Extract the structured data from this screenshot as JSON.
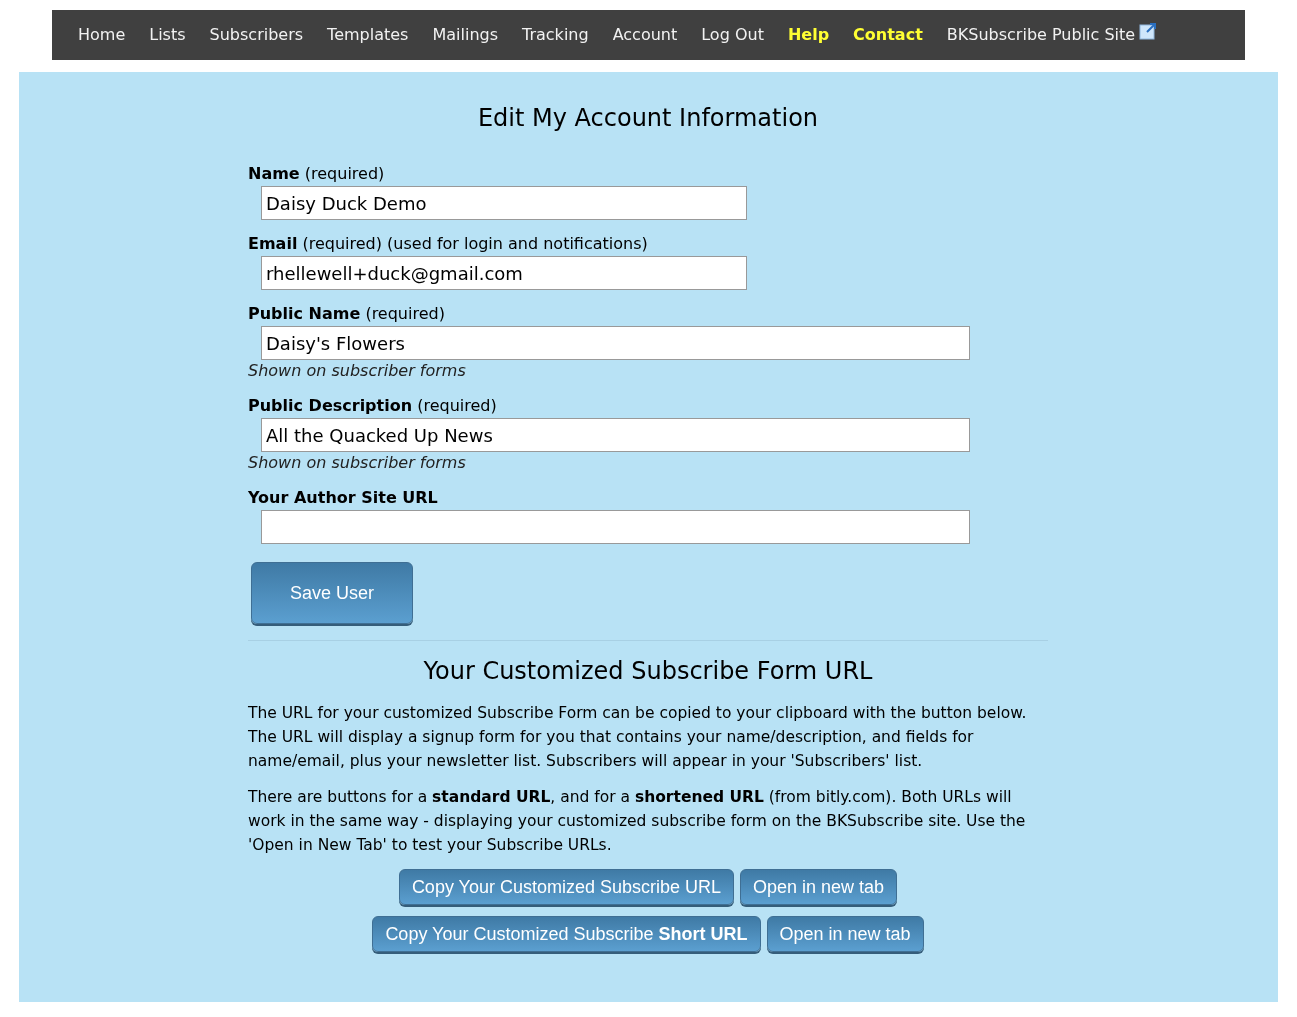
{
  "nav": [
    {
      "label": "Home",
      "highlighted": false
    },
    {
      "label": "Lists",
      "highlighted": false
    },
    {
      "label": "Subscribers",
      "highlighted": false
    },
    {
      "label": "Templates",
      "highlighted": false
    },
    {
      "label": "Mailings",
      "highlighted": false
    },
    {
      "label": "Tracking",
      "highlighted": false
    },
    {
      "label": "Account",
      "highlighted": false
    },
    {
      "label": "Log Out",
      "highlighted": false
    },
    {
      "label": "Help",
      "highlighted": true
    },
    {
      "label": "Contact",
      "highlighted": true
    },
    {
      "label": "BKSubscribe Public Site",
      "highlighted": false,
      "external": true
    }
  ],
  "title": "Edit My Account Information",
  "fields": [
    {
      "label": "Name",
      "note": "(required)",
      "value": "Daisy Duck Demo",
      "kind": "short"
    },
    {
      "label": "Email",
      "note": "(required) (used for login and notifications)",
      "value": "rhellewell+duck@gmail.com",
      "kind": "short"
    },
    {
      "label": "Public Name",
      "note": "(required)",
      "value": "Daisy's Flowers",
      "hint": "Shown on subscriber forms",
      "kind": "long"
    },
    {
      "label": "Public Description",
      "note": "(required)",
      "value": "All the Quacked Up News",
      "hint": "Shown on subscriber forms",
      "kind": "long"
    },
    {
      "label": "Your Author Site URL",
      "kind": "long"
    }
  ],
  "save_button": "Save User",
  "subscribe_section": {
    "title": "Your Customized Subscribe Form URL",
    "paragraphs": [
      "The URL for your customized Subscribe Form can be copied to your clipboard with the button below. The URL will display a signup form for you that contains your name/description, and fields for name/email, plus your newsletter list. Subscribers will appear in your 'Subscribers' list.",
      "There are buttons for a **standard URL**, and for a **shortened URL** (from bitly.com). Both URLs will work in the same way - displaying your customized subscribe form on the BKSubscribe site. Use the 'Open in New Tab' to test your Subscribe URLs."
    ],
    "button_rows": [
      [
        "Copy Your Customized Subscribe URL",
        "Open in new tab"
      ],
      [
        "Copy Your Customized Subscribe **Short URL**",
        "Open in new tab"
      ]
    ]
  }
}
